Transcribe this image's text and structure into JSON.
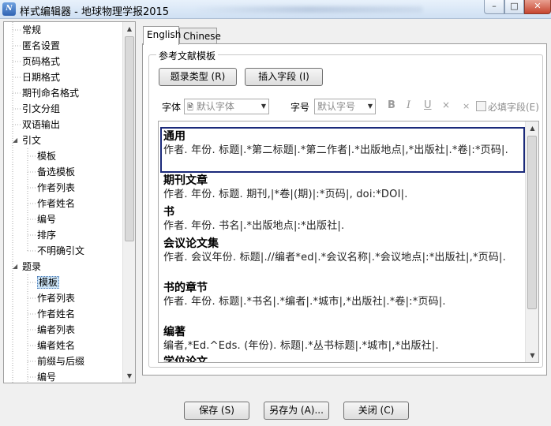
{
  "window": {
    "title": "样式编辑器 - 地球物理学报2015",
    "app_icon_text": "N"
  },
  "tree": {
    "items": [
      {
        "label": "常规",
        "level": 0
      },
      {
        "label": "匿名设置",
        "level": 0
      },
      {
        "label": "页码格式",
        "level": 0
      },
      {
        "label": "日期格式",
        "level": 0
      },
      {
        "label": "期刊命名格式",
        "level": 0
      },
      {
        "label": "引文分组",
        "level": 0
      },
      {
        "label": "双语输出",
        "level": 0
      },
      {
        "label": "引文",
        "level": 0,
        "expanded": true
      },
      {
        "label": "模板",
        "level": 1
      },
      {
        "label": "备选模板",
        "level": 1
      },
      {
        "label": "作者列表",
        "level": 1
      },
      {
        "label": "作者姓名",
        "level": 1
      },
      {
        "label": "编号",
        "level": 1
      },
      {
        "label": "排序",
        "level": 1
      },
      {
        "label": "不明确引文",
        "level": 1
      },
      {
        "label": "题录",
        "level": 0,
        "expanded": true
      },
      {
        "label": "模板",
        "level": 1,
        "selected": true
      },
      {
        "label": "作者列表",
        "level": 1
      },
      {
        "label": "作者姓名",
        "level": 1
      },
      {
        "label": "编者列表",
        "level": 1
      },
      {
        "label": "编者姓名",
        "level": 1
      },
      {
        "label": "前缀与后缀",
        "level": 1
      },
      {
        "label": "编号",
        "level": 1
      }
    ]
  },
  "tabs": [
    {
      "label": "English",
      "active": true
    },
    {
      "label": "Chinese",
      "active": false
    }
  ],
  "group": {
    "title": "参考文献模板",
    "ref_type_button": "题录类型 (R)",
    "insert_field_button": "插入字段 (I)",
    "font_label": "字体",
    "font_value": "默认字体",
    "size_label": "字号",
    "size_value": "默认字号",
    "bold": "B",
    "italic": "I",
    "underline": "U",
    "superscript": "×",
    "subscript": "×",
    "required_field_label": "必填字段(E)"
  },
  "templates": [
    {
      "name": "通用",
      "body": "作者. 年份. 标题|.*第二标题|.*第二作者|.*出版地点|,*出版社|.*卷|:*页码|."
    },
    {
      "name": "期刊文章",
      "body": "作者. 年份. 标题. 期刊,|*卷|(期)|:*页码|, doi:*DOI|."
    },
    {
      "name": "书",
      "body": "作者. 年份. 书名|.*出版地点|:*出版社|."
    },
    {
      "name": "会议论文集",
      "body": "作者. 会议年份. 标题|.//编者*ed|.*会议名称|.*会议地点|:*出版社|,*页码|."
    },
    {
      "name": "书的章节",
      "body": "作者. 年份. 标题|.*书名|.*编者|.*城市|,*出版社|.*卷|:*页码|."
    },
    {
      "name": "编著",
      "body": "编者,*Ed.^Eds. (年份). 标题|.*丛书标题|.*城市|,*出版社|."
    },
    {
      "name": "学位论文",
      "body": ""
    }
  ],
  "footer": {
    "save_button": "保存 (S)",
    "save_as_button": "另存为 (A)...",
    "close_button": "关闭 (C)"
  }
}
